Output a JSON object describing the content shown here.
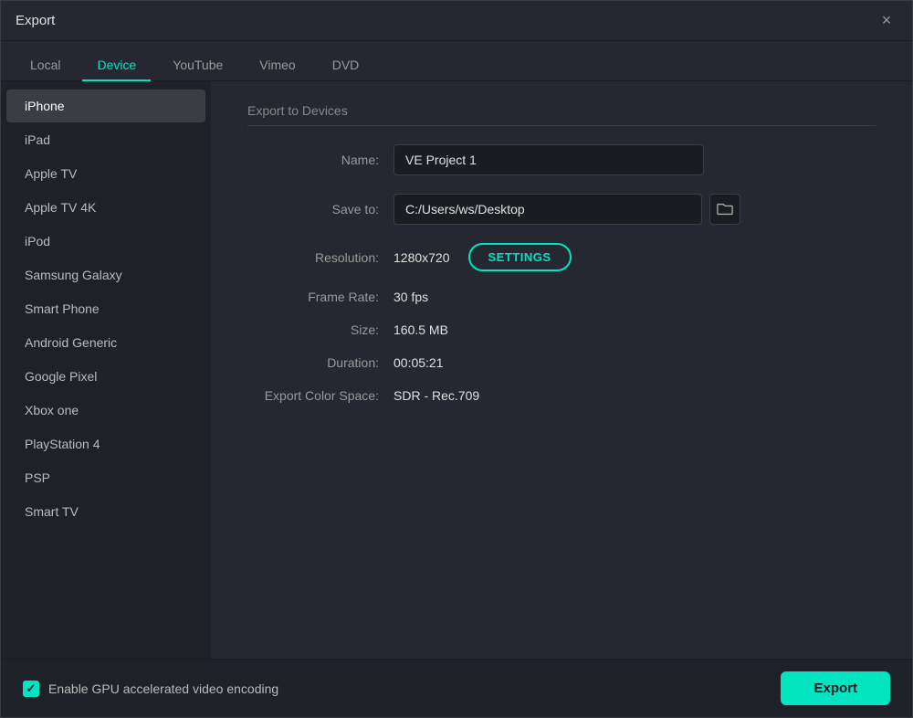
{
  "window": {
    "title": "Export",
    "close_label": "×"
  },
  "tabs": [
    {
      "id": "local",
      "label": "Local",
      "active": false
    },
    {
      "id": "device",
      "label": "Device",
      "active": true
    },
    {
      "id": "youtube",
      "label": "YouTube",
      "active": false
    },
    {
      "id": "vimeo",
      "label": "Vimeo",
      "active": false
    },
    {
      "id": "dvd",
      "label": "DVD",
      "active": false
    }
  ],
  "sidebar": {
    "items": [
      {
        "id": "iphone",
        "label": "iPhone",
        "active": true
      },
      {
        "id": "ipad",
        "label": "iPad",
        "active": false
      },
      {
        "id": "apple-tv",
        "label": "Apple TV",
        "active": false
      },
      {
        "id": "apple-tv-4k",
        "label": "Apple TV 4K",
        "active": false
      },
      {
        "id": "ipod",
        "label": "iPod",
        "active": false
      },
      {
        "id": "samsung-galaxy",
        "label": "Samsung Galaxy",
        "active": false
      },
      {
        "id": "smart-phone",
        "label": "Smart Phone",
        "active": false
      },
      {
        "id": "android-generic",
        "label": "Android Generic",
        "active": false
      },
      {
        "id": "google-pixel",
        "label": "Google Pixel",
        "active": false
      },
      {
        "id": "xbox-one",
        "label": "Xbox one",
        "active": false
      },
      {
        "id": "playstation-4",
        "label": "PlayStation 4",
        "active": false
      },
      {
        "id": "psp",
        "label": "PSP",
        "active": false
      },
      {
        "id": "smart-tv",
        "label": "Smart TV",
        "active": false
      }
    ]
  },
  "main": {
    "section_title": "Export to Devices",
    "fields": {
      "name_label": "Name:",
      "name_value": "VE Project 1",
      "save_to_label": "Save to:",
      "save_to_value": "C:/Users/ws/Desktop",
      "resolution_label": "Resolution:",
      "resolution_value": "1280x720",
      "frame_rate_label": "Frame Rate:",
      "frame_rate_value": "30 fps",
      "size_label": "Size:",
      "size_value": "160.5 MB",
      "duration_label": "Duration:",
      "duration_value": "00:05:21",
      "color_space_label": "Export Color Space:",
      "color_space_value": "SDR - Rec.709",
      "settings_btn_label": "SETTINGS"
    }
  },
  "bottom": {
    "checkbox_label": "Enable GPU accelerated video encoding",
    "export_btn_label": "Export"
  },
  "icons": {
    "folder": "🗁",
    "check": "✓"
  }
}
